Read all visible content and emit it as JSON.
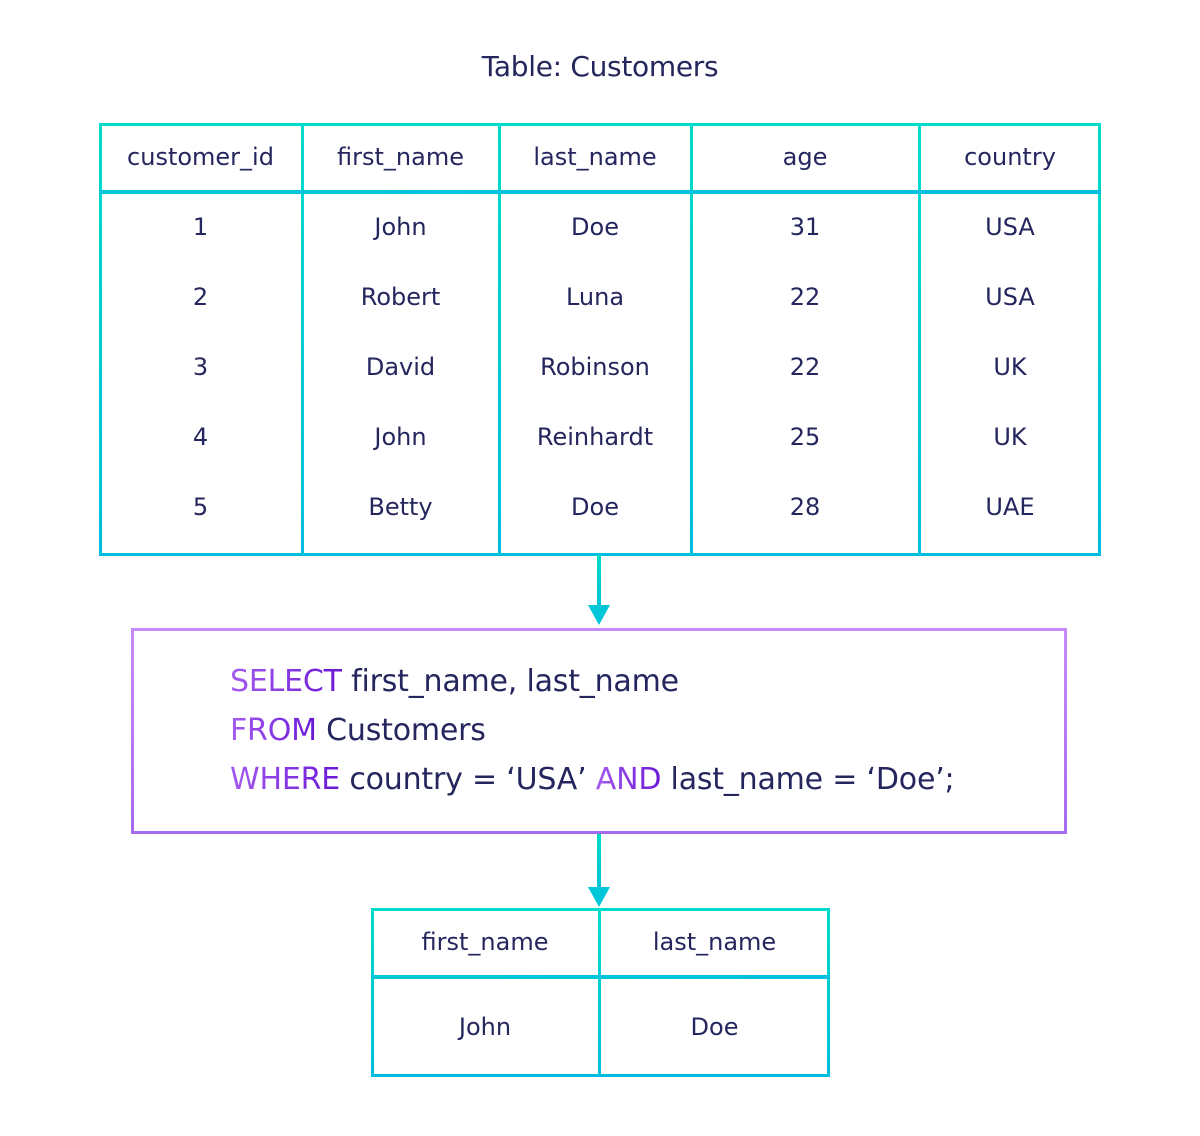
{
  "title": "Table: Customers",
  "source_table": {
    "name": "Customers",
    "columns": [
      "customer_id",
      "first_name",
      "last_name",
      "age",
      "country"
    ],
    "rows": [
      [
        "1",
        "John",
        "Doe",
        "31",
        "USA"
      ],
      [
        "2",
        "Robert",
        "Luna",
        "22",
        "USA"
      ],
      [
        "3",
        "David",
        "Robinson",
        "22",
        "UK"
      ],
      [
        "4",
        "John",
        "Reinhardt",
        "25",
        "UK"
      ],
      [
        "5",
        "Betty",
        "Doe",
        "28",
        "UAE"
      ]
    ]
  },
  "query": {
    "lines": [
      {
        "keyword": "SELECT",
        "text": " first_name, last_name"
      },
      {
        "keyword": "FROM",
        "text": " Customers"
      },
      {
        "keyword": "WHERE",
        "text": " country = ‘USA’ ",
        "keyword2": "AND",
        "text2": " last_name = ‘Doe’;"
      }
    ]
  },
  "result_table": {
    "columns": [
      "first_name",
      "last_name"
    ],
    "rows": [
      [
        "John",
        "Doe"
      ]
    ]
  },
  "colors": {
    "table_border_top": "#00DCCB",
    "table_border_bottom": "#00BEE0",
    "query_border_top": "#C68CFC",
    "query_border_bottom": "#A56BEF",
    "keyword_start": "#A55CF0",
    "keyword_end": "#6A16D6",
    "text": "#25265E"
  }
}
